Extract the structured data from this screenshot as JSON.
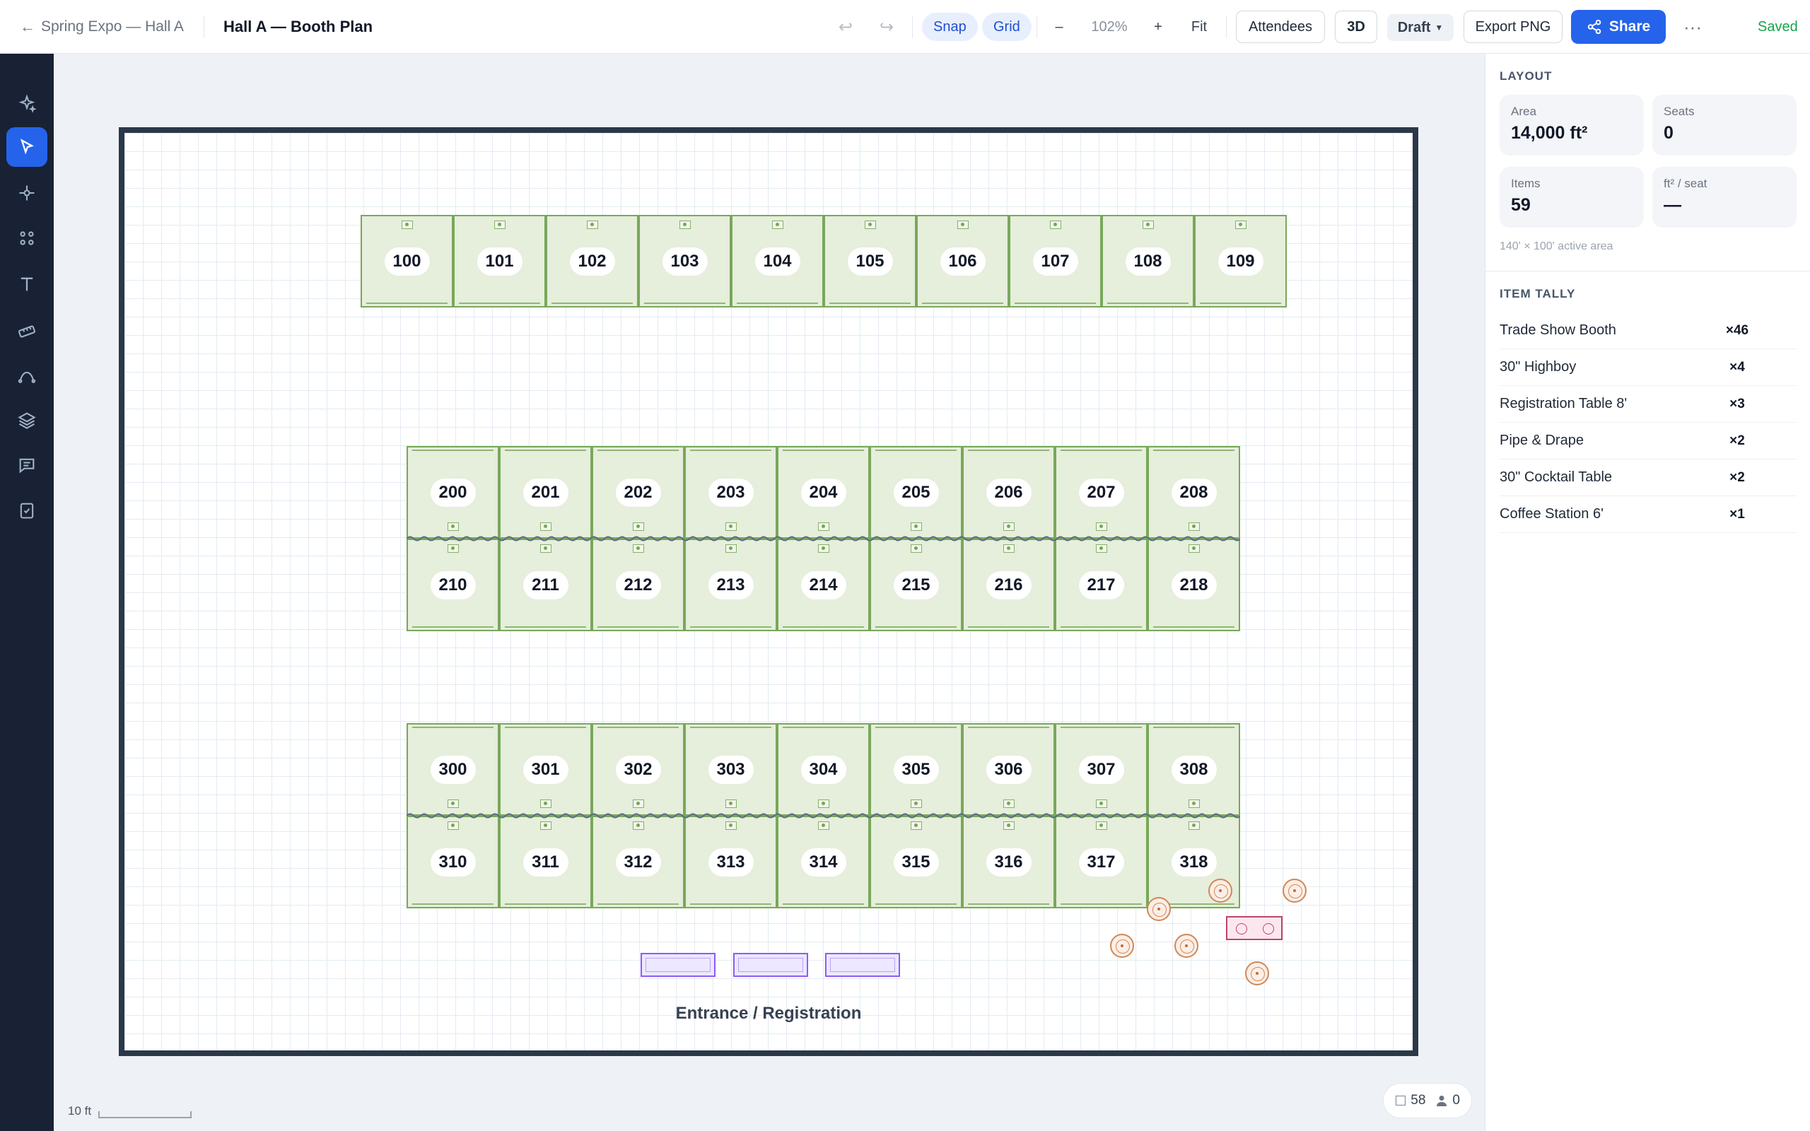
{
  "header": {
    "back_label": "Spring Expo — Hall A",
    "title": "Hall A — Booth Plan",
    "snap_label": "Snap",
    "grid_label": "Grid",
    "zoom_out": "–",
    "zoom_level": "102%",
    "zoom_in": "+",
    "fit_label": "Fit",
    "attendees_label": "Attendees",
    "view3d_label": "3D",
    "status_label": "Draft",
    "export_label": "Export PNG",
    "share_label": "Share",
    "more_label": "···",
    "saved_label": "Saved"
  },
  "toolbar": {
    "tools": [
      "magic-wand-icon",
      "pointer-icon",
      "node-icon",
      "grid-dots-icon",
      "text-icon",
      "ruler-icon",
      "curve-icon",
      "layers-icon",
      "comment-icon",
      "checklist-icon"
    ],
    "active_tool": "pointer-icon"
  },
  "canvas": {
    "booth_rows": [
      [
        "100",
        "101",
        "102",
        "103",
        "104",
        "105",
        "106",
        "107",
        "108",
        "109"
      ],
      [
        "200",
        "201",
        "202",
        "203",
        "204",
        "205",
        "206",
        "207",
        "208"
      ],
      [
        "210",
        "211",
        "212",
        "213",
        "214",
        "215",
        "216",
        "217",
        "218"
      ],
      [
        "300",
        "301",
        "302",
        "303",
        "304",
        "305",
        "306",
        "307",
        "308"
      ],
      [
        "310",
        "311",
        "312",
        "313",
        "314",
        "315",
        "316",
        "317",
        "318"
      ]
    ],
    "entrance_label": "Entrance / Registration",
    "scale_label": "10 ft",
    "status_items": "58",
    "status_people": "0"
  },
  "layout": {
    "heading": "LAYOUT",
    "area_label": "Area",
    "area_value": "14,000 ft²",
    "seats_label": "Seats",
    "seats_value": "0",
    "items_label": "Items",
    "items_value": "59",
    "ratio_label": "ft² / seat",
    "ratio_value": "—",
    "note": "140' × 100' active area"
  },
  "tally": {
    "heading": "ITEM TALLY",
    "items": [
      {
        "name": "Trade Show Booth",
        "count": "×46"
      },
      {
        "name": "30\" Highboy",
        "count": "×4"
      },
      {
        "name": "Registration Table 8'",
        "count": "×3"
      },
      {
        "name": "Pipe & Drape",
        "count": "×2"
      },
      {
        "name": "30\" Cocktail Table",
        "count": "×2"
      },
      {
        "name": "Coffee Station 6'",
        "count": "×1"
      }
    ]
  },
  "colors": {
    "accent": "#2563eb",
    "booth_fill": "#e6eedc",
    "booth_border": "#78a85a",
    "registration": "#8b5cf6",
    "highboy": "#d08856",
    "coffee_station": "#c2416b",
    "saved": "#16a34a"
  }
}
